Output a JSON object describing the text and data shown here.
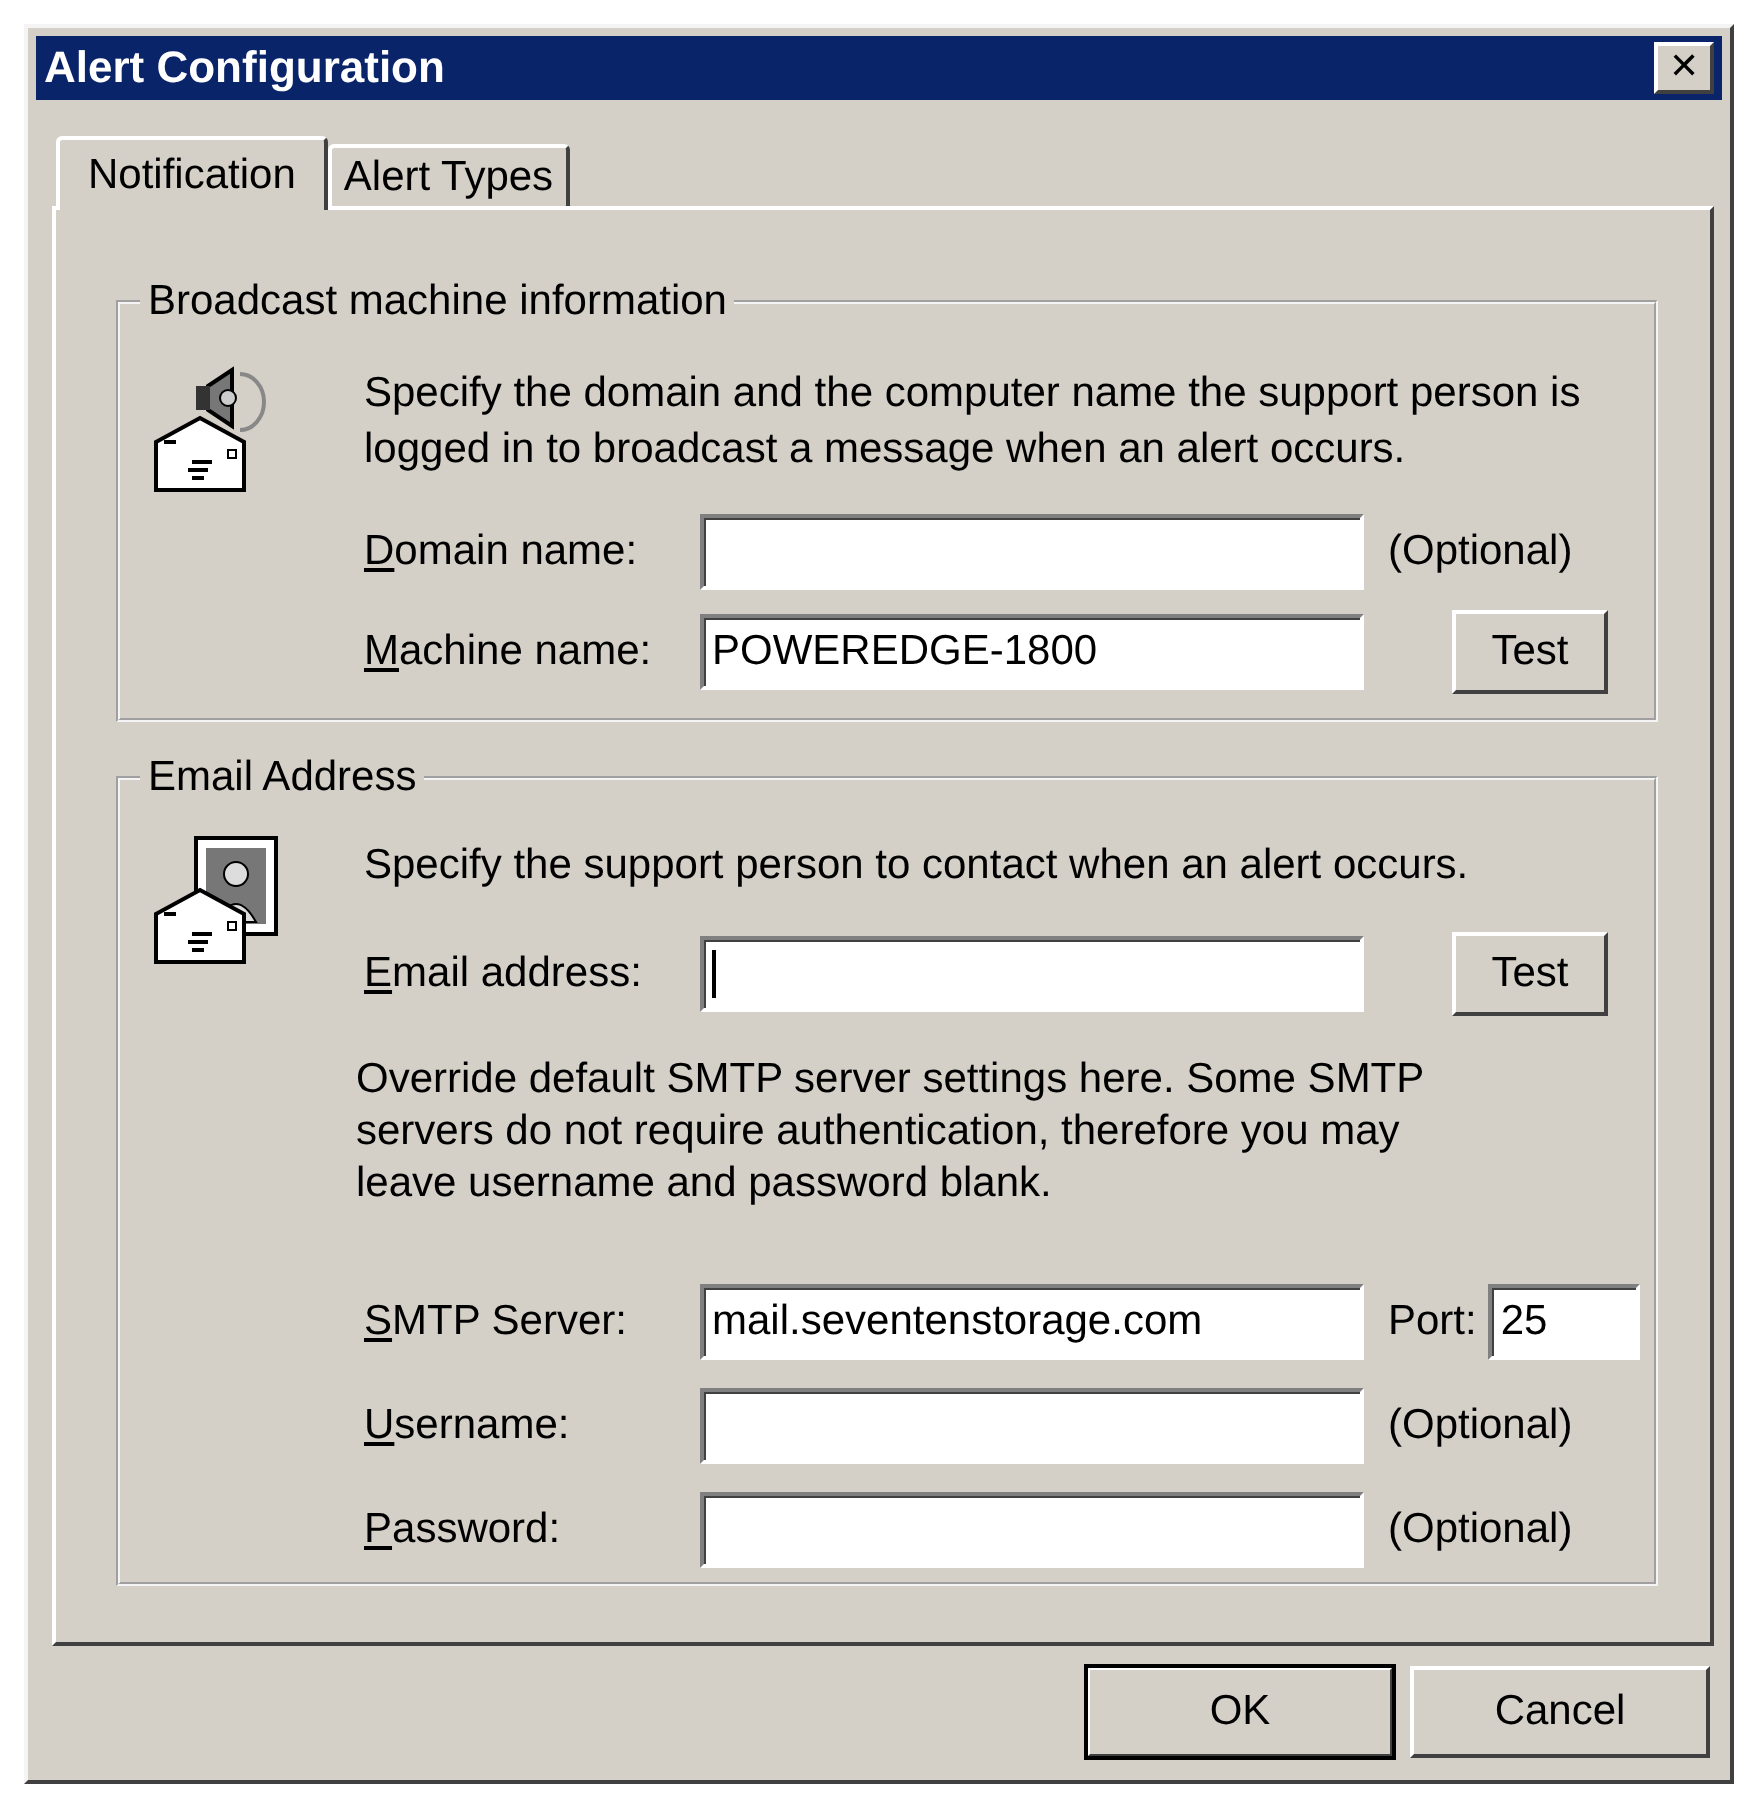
{
  "window": {
    "title": "Alert Configuration",
    "close": "✕"
  },
  "tabs": [
    {
      "label": "Notification",
      "selected": true
    },
    {
      "label": "Alert Types",
      "selected": false
    }
  ],
  "groups": [
    {
      "title": "Broadcast machine information",
      "kind": "broadcast",
      "description": "Specify the domain and the computer name the support person is logged in to broadcast a message when an alert occurs.",
      "rows": [
        {
          "label": "Domain name:",
          "value": "",
          "suffix": {
            "kind": "note",
            "text": "(Optional)"
          }
        },
        {
          "label": "Machine name:",
          "value": "POWEREDGE-1800",
          "suffix": {
            "kind": "button",
            "text": "Test"
          }
        }
      ]
    },
    {
      "title": "Email Address",
      "kind": "email",
      "description": "Specify the support person to contact when an alert occurs.",
      "rows": [
        {
          "label": "Email address:",
          "value": "",
          "focused": true,
          "suffix": {
            "kind": "button",
            "text": "Test"
          }
        },
        {
          "kind": "paragraph",
          "text": "Override default SMTP server settings here. Some SMTP servers do not require authentication, therefore you may leave username and password blank."
        },
        {
          "label": "SMTP Server:",
          "value": "mail.seventenstorage.com",
          "suffix": {
            "kind": "port",
            "text": "Port:",
            "value": "25"
          }
        },
        {
          "label": "Username:",
          "value": "",
          "suffix": {
            "kind": "note",
            "text": "(Optional)"
          }
        },
        {
          "label": "Password:",
          "value": "",
          "suffix": {
            "kind": "note",
            "text": "(Optional)"
          }
        }
      ]
    }
  ],
  "buttons": [
    {
      "label": "OK",
      "default": true
    },
    {
      "label": "Cancel",
      "default": false
    }
  ]
}
